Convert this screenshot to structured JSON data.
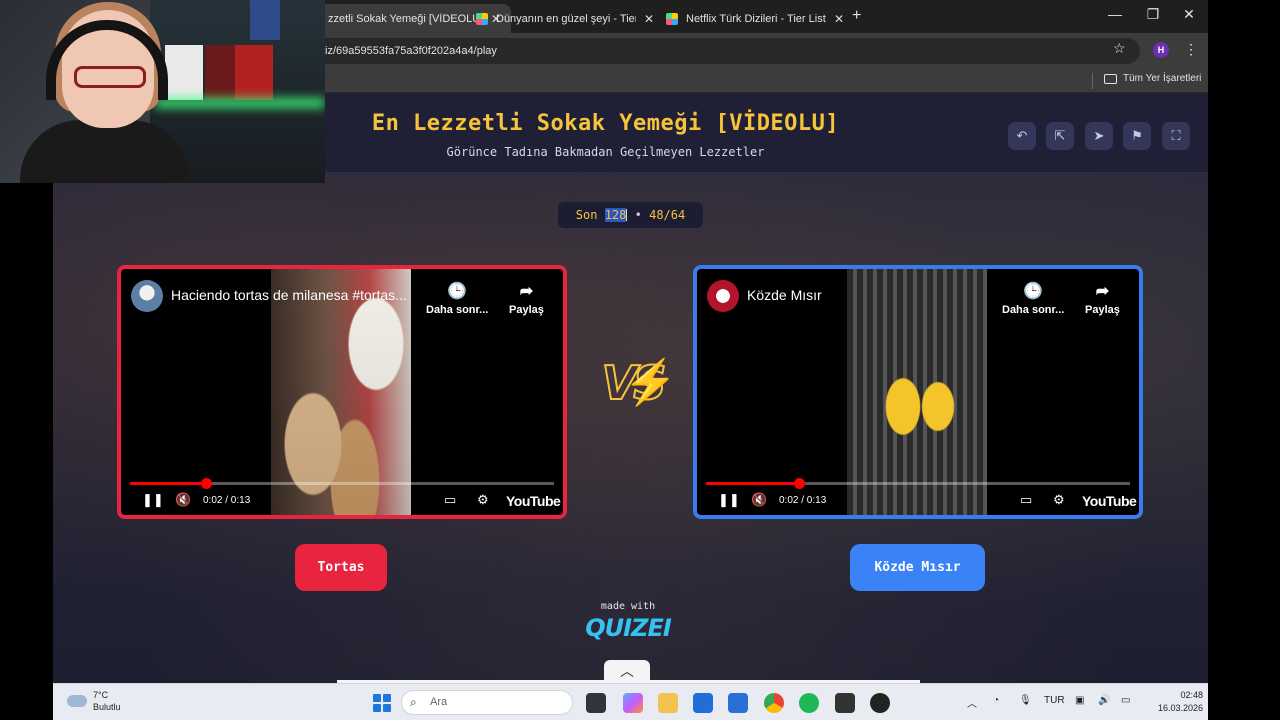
{
  "browser": {
    "tabs": [
      {
        "label": "zzetli Sokak Yemeği [VİDEOLU]",
        "active": true
      },
      {
        "label": "Dünyanın en güzel şeyi - Tier List",
        "active": false
      },
      {
        "label": "Netflix Türk Dizileri - Tier List | ...",
        "active": false
      }
    ],
    "url": "iz/69a59553fa75a3f0f202a4a4/play",
    "profile_initial": "H",
    "bookmarks_folder": "Tüm Yer İşaretleri"
  },
  "page": {
    "title": "En Lezzetli Sokak Yemeği [VİDEOLU]",
    "subtitle": "Görünce Tadına Bakmadan Geçilmeyen Lezzetler",
    "round": {
      "label": "Son",
      "selected": "128",
      "sep": "•",
      "progress": "48/64"
    },
    "left": {
      "video_title": "Haciendo tortas de milanesa #tortas...",
      "watch_later": "Daha sonr...",
      "share": "Paylaş",
      "time": "0:02 / 0:13",
      "progress_fraction": 0.18,
      "vote_label": "Tortas",
      "color": "#e8243f"
    },
    "right": {
      "video_title": "Közde Mısır",
      "watch_later": "Daha sonr...",
      "share": "Paylaş",
      "time": "0:02 / 0:13",
      "progress_fraction": 0.22,
      "vote_label": "Közde Mısır",
      "color": "#3a7cf0"
    },
    "vs_text": "VS",
    "youtube_logo": "YouTube",
    "made_with": "made with",
    "brand": "QUIZEI"
  },
  "taskbar": {
    "weather_temp": "7°C",
    "weather_desc": "Bulutlu",
    "search_placeholder": "Ara",
    "language": "TUR",
    "time": "02:48",
    "date": "16.03.2026"
  }
}
